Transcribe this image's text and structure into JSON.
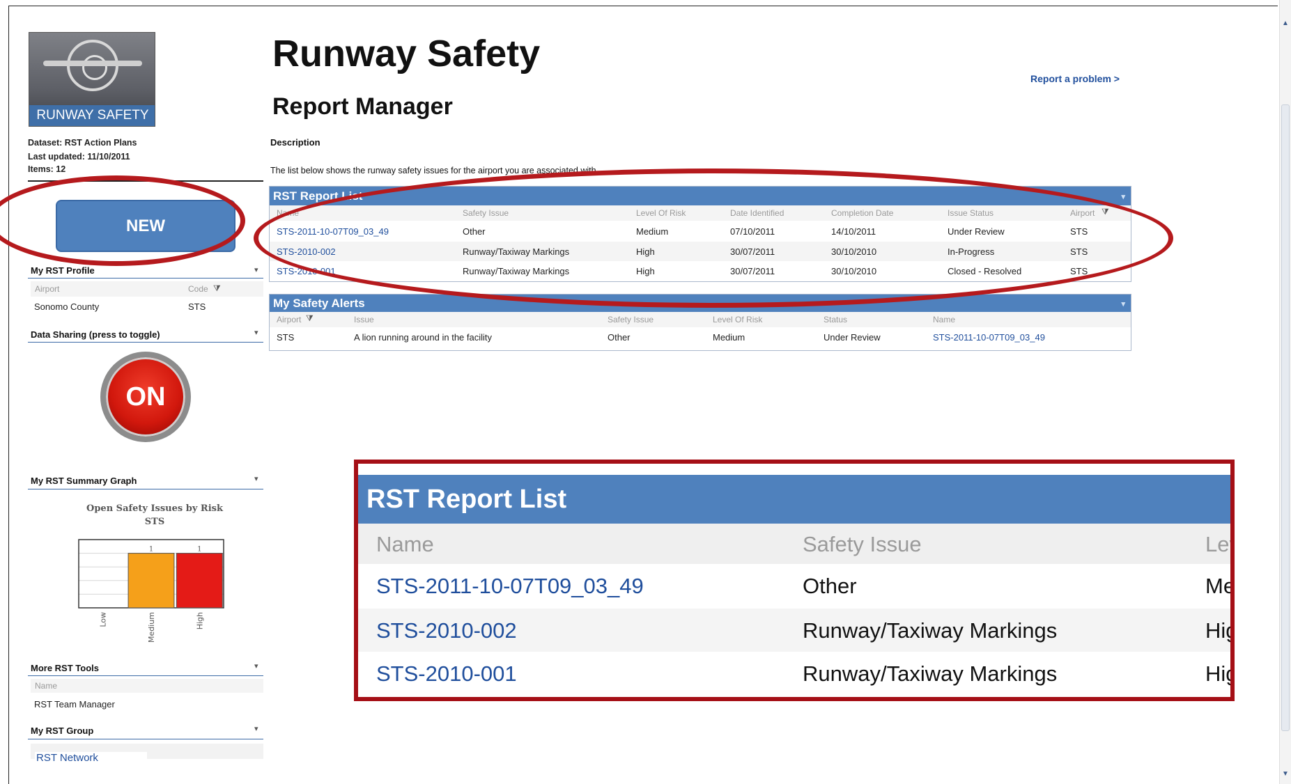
{
  "sidebar": {
    "logo_text": "RUNWAY SAFETY",
    "dataset": "Dataset: RST Action Plans",
    "last_updated": "Last updated: 11/10/2011",
    "items": "Items: 12",
    "new_button": "NEW",
    "profile": {
      "title": "My RST Profile",
      "columns": [
        "Airport",
        "Code"
      ],
      "row": [
        "Sonomo County",
        "STS"
      ]
    },
    "data_sharing": {
      "title": "Data Sharing (press to toggle)",
      "toggle_label": "ON"
    },
    "summary_graph": {
      "title": "My RST Summary Graph"
    },
    "tools": {
      "title": "More RST Tools",
      "column": "Name",
      "item": "RST Team Manager"
    },
    "group": {
      "title": "My RST Group",
      "item": "RST Network"
    }
  },
  "main": {
    "title": "Runway Safety",
    "subtitle": "Report Manager",
    "report_link": "Report a problem >",
    "description_label": "Description",
    "description_text": "The list below shows the runway safety issues for the airport you are associated with"
  },
  "report_list": {
    "title": "RST Report List",
    "columns": [
      "Name",
      "Safety Issue",
      "Level Of Risk",
      "Date Identified",
      "Completion Date",
      "Issue Status",
      "Airport"
    ],
    "rows": [
      [
        "STS-2011-10-07T09_03_49",
        "Other",
        "Medium",
        "07/10/2011",
        "14/10/2011",
        "Under Review",
        "STS"
      ],
      [
        "STS-2010-002",
        "Runway/Taxiway Markings",
        "High",
        "30/07/2011",
        "30/10/2010",
        "In-Progress",
        "STS"
      ],
      [
        "STS-2010-001",
        "Runway/Taxiway Markings",
        "High",
        "30/07/2011",
        "30/10/2010",
        "Closed - Resolved",
        "STS"
      ]
    ]
  },
  "alerts": {
    "title": "My Safety Alerts",
    "columns": [
      "Airport",
      "Issue",
      "Safety Issue",
      "Level Of Risk",
      "Status",
      "Name"
    ],
    "row": [
      "STS",
      "A lion running around in the facility",
      "Other",
      "Medium",
      "Under Review",
      "STS-2011-10-07T09_03_49"
    ]
  },
  "zoom": {
    "title": "RST Report List",
    "columns": [
      "Name",
      "Safety Issue",
      "Lev"
    ],
    "rows": [
      [
        "STS-2011-10-07T09_03_49",
        "Other",
        "Me"
      ],
      [
        "STS-2010-002",
        "Runway/Taxiway Markings",
        "Hig"
      ],
      [
        "STS-2010-001",
        "Runway/Taxiway Markings",
        "Hig"
      ]
    ]
  },
  "chart_data": {
    "type": "bar",
    "title": "Open Safety Issues by Risk",
    "subtitle": "STS",
    "categories": [
      "Low",
      "Medium",
      "High"
    ],
    "values": [
      0,
      1,
      1
    ],
    "colors": [
      "#f5a01a",
      "#f5a01a",
      "#e41b17"
    ],
    "ylim": [
      0,
      1.25
    ]
  },
  "colors": {
    "accent": "#4f81bd",
    "annotation": "#b51a1d",
    "link": "#1f4e9c"
  }
}
